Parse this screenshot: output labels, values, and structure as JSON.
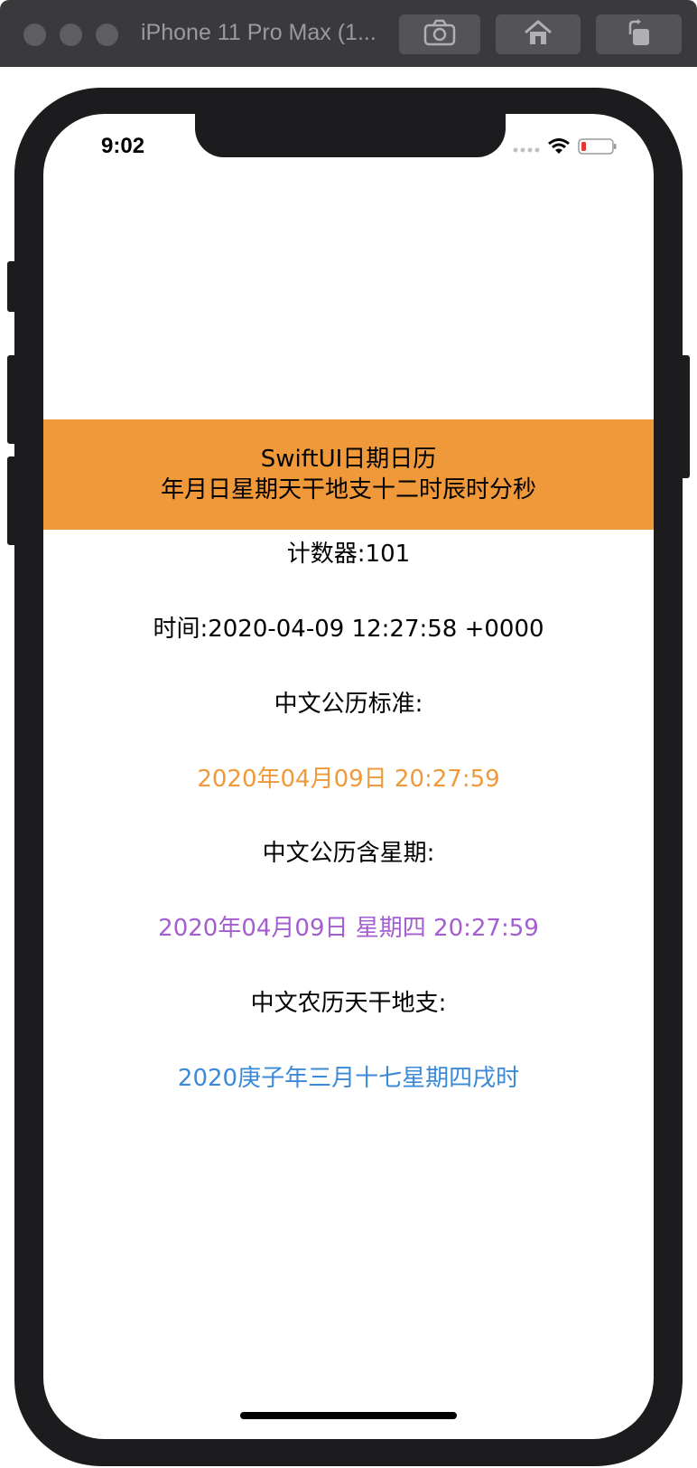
{
  "window": {
    "title": "iPhone 11 Pro Max (1..."
  },
  "status_bar": {
    "time": "9:02",
    "battery_color": "#e53935"
  },
  "banner": {
    "color": "#f0993a",
    "title": "SwiftUI日期日历",
    "subtitle": "年月日星期天干地支十二时辰时分秒"
  },
  "content": {
    "counter": "计数器:101",
    "time": "时间:2020-04-09 12:27:58 +0000",
    "gregorian_label": "中文公历标准:",
    "gregorian_value": "2020年04月09日 20:27:59",
    "gregorian_color": "#f0993a",
    "weekday_label": "中文公历含星期:",
    "weekday_value": "2020年04月09日 星期四 20:27:59",
    "weekday_color": "#a45ed0",
    "lunar_label": "中文农历天干地支:",
    "lunar_value": "2020庚子年三月十七星期四戌时",
    "lunar_color": "#3a8ad8"
  },
  "icons": {
    "screenshot": "camera-icon",
    "home": "home-icon",
    "rotate": "rotate-icon",
    "wifi": "wifi-icon",
    "signal": "signal-icon",
    "battery": "battery-icon"
  }
}
